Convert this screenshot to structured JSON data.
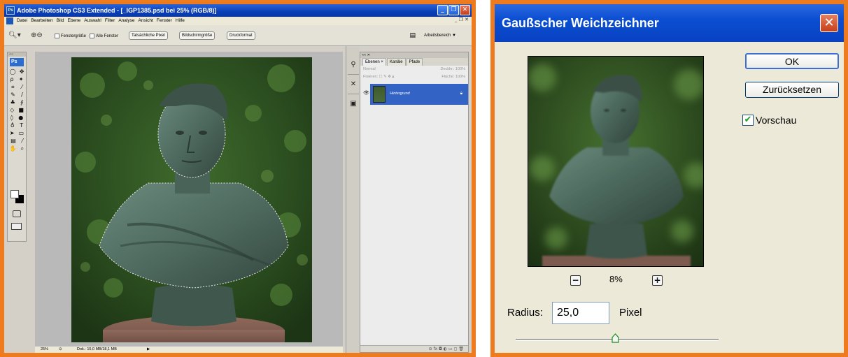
{
  "photoshop": {
    "title": "Adobe Photoshop CS3 Extended - [_IGP1385.psd bei 25% (RGB/8)]",
    "menu": [
      "Datei",
      "Bearbeiten",
      "Bild",
      "Ebene",
      "Auswahl",
      "Filter",
      "Analyse",
      "Ansicht",
      "Fenster",
      "Hilfe"
    ],
    "options": {
      "fenstergroesse_label": "Fenstergröße",
      "alle_fenster_label": "Alle Fenster",
      "tatsaechliche_pixel": "Tatsächliche Pixel",
      "bildschirmgroesse": "Bildschirmgröße",
      "druckformat": "Druckformat",
      "arbeitsbereich": "Arbeitsbereich ▼"
    },
    "toolbox_logo": "Ps",
    "status": {
      "zoom": "25%",
      "doc": "Dok.: 15,0 MB/18,1 MB"
    },
    "layers_panel": {
      "tabs": [
        "Ebenen ×",
        "Kanäle",
        "Pfade"
      ],
      "blend_mode": "Normal",
      "opacity_label": "Deckkr.:",
      "opacity_value": "100%",
      "fix_label": "Fixieren:",
      "fill_label": "Fläche:",
      "fill_value": "100%",
      "layer_name": "Hintergrund",
      "footer_icons": "⊖ fx ◘ ◐ ▭ ◻ 🗑"
    }
  },
  "gauss_dialog": {
    "title": "Gaußscher Weichzeichner",
    "ok_label": "OK",
    "reset_label": "Zurücksetzen",
    "preview_label": "Vorschau",
    "preview_checked": true,
    "zoom_value": "8%",
    "radius_label": "Radius:",
    "radius_value": "25,0",
    "radius_unit": "Pixel",
    "slider_level": 0.49,
    "colors": {
      "title_blue": "#0b4ed2",
      "close_red": "#c6401a",
      "frame_orange": "#ef7b1f"
    }
  }
}
